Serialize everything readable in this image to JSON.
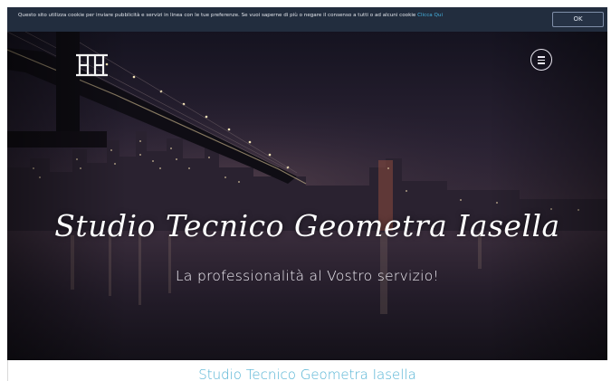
{
  "cookie_bar": {
    "text": "Questo sito utilizza cookie per inviare pubblicità e servizi in linea con le tue preferenze. Se vuoi saperne di più o negare il consenso a tutti o ad alcuni cookie",
    "link_label": "Clicca Qui",
    "ok_label": "OK"
  },
  "header": {
    "logo_icon": "monogram-logo-icon",
    "menu_icon": "hamburger-menu-icon"
  },
  "hero": {
    "title": "Studio Tecnico Geometra Iasella",
    "subtitle": "La professionalità al Vostro servizio!"
  },
  "section": {
    "title": "Studio Tecnico Geometra Iasella"
  },
  "colors": {
    "cookie_bar_bg": "#222d3e",
    "link": "#46b2e0",
    "section_title": "#53b3d4"
  }
}
